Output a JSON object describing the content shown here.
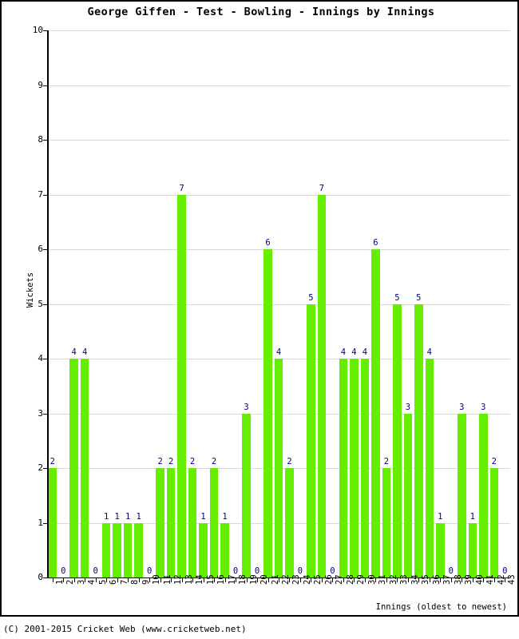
{
  "chart_data": {
    "type": "bar",
    "title": "George Giffen - Test - Bowling - Innings by Innings",
    "xlabel": "Innings (oldest to newest)",
    "ylabel": "Wickets",
    "ylim": [
      0,
      10
    ],
    "ytick_labels": [
      "0",
      "1",
      "2",
      "3",
      "4",
      "5",
      "6",
      "7",
      "8",
      "9",
      "10"
    ],
    "grid": true,
    "legend": null,
    "bar_color": "#66ee00",
    "value_label_color": "#000080",
    "categories": [
      "1",
      "2",
      "3",
      "4",
      "5",
      "6",
      "7",
      "8",
      "9",
      "10",
      "11",
      "12",
      "13",
      "14",
      "15",
      "16",
      "17",
      "18",
      "19",
      "20",
      "21",
      "22",
      "23",
      "24",
      "25",
      "26",
      "27",
      "28",
      "29",
      "30",
      "31",
      "32",
      "33",
      "34",
      "35",
      "36",
      "37",
      "38",
      "39",
      "40",
      "41",
      "42",
      "43"
    ],
    "values": [
      2,
      0,
      4,
      4,
      0,
      1,
      1,
      1,
      1,
      0,
      2,
      2,
      7,
      2,
      1,
      2,
      1,
      0,
      3,
      0,
      6,
      4,
      2,
      0,
      5,
      7,
      0,
      4,
      4,
      4,
      6,
      2,
      5,
      3,
      5,
      4,
      1,
      0,
      3,
      1,
      3,
      2,
      0
    ],
    "value_labels": [
      "2",
      "0",
      "4",
      "4",
      "0",
      "1",
      "1",
      "1",
      "1",
      "0",
      "2",
      "2",
      "7",
      "2",
      "1",
      "2",
      "1",
      "0",
      "3",
      "0",
      "6",
      "4",
      "2",
      "0",
      "5",
      "7",
      "0",
      "4",
      "4",
      "4",
      "6",
      "2",
      "5",
      "3",
      "5",
      "4",
      "1",
      "0",
      "3",
      "1",
      "3",
      "2",
      "0"
    ]
  },
  "footer": {
    "copyright": "(C) 2001-2015 Cricket Web (www.cricketweb.net)"
  }
}
